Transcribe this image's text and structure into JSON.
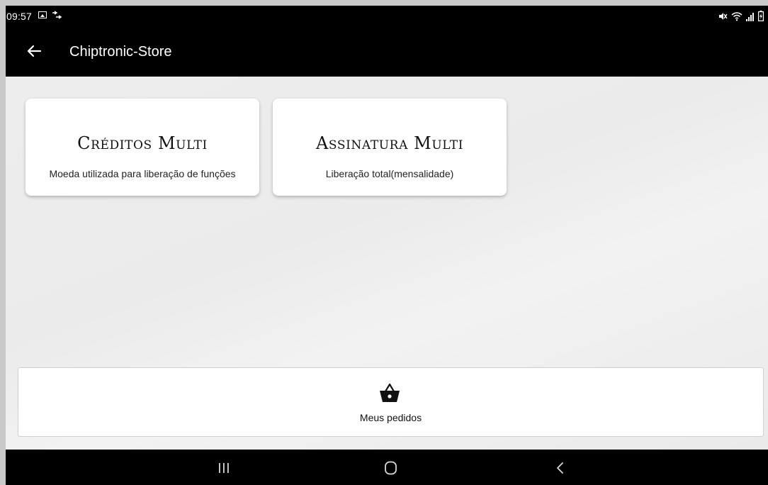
{
  "status_bar": {
    "time": "09:57",
    "left_icons": [
      "gallery-icon",
      "cast-icon"
    ],
    "right_icons": [
      "mute-icon",
      "wifi-icon",
      "signal-icon",
      "battery-icon"
    ]
  },
  "app_bar": {
    "title": "Chiptronic-Store",
    "back_icon": "back-arrow-icon"
  },
  "cards": [
    {
      "title": "Créditos Multi",
      "subtitle": "Moeda utilizada para liberação de funções"
    },
    {
      "title": "Assinatura Multi",
      "subtitle": "Liberação total(mensalidade)"
    }
  ],
  "orders": {
    "label": "Meus pedidos",
    "icon": "basket-icon"
  },
  "nav_bar": {
    "buttons": [
      "recent-apps-icon",
      "home-icon",
      "back-icon"
    ]
  },
  "colors": {
    "bar_background": "#000000",
    "content_background": "#eeeeee",
    "card_background": "#ffffff",
    "text": "#111111"
  }
}
